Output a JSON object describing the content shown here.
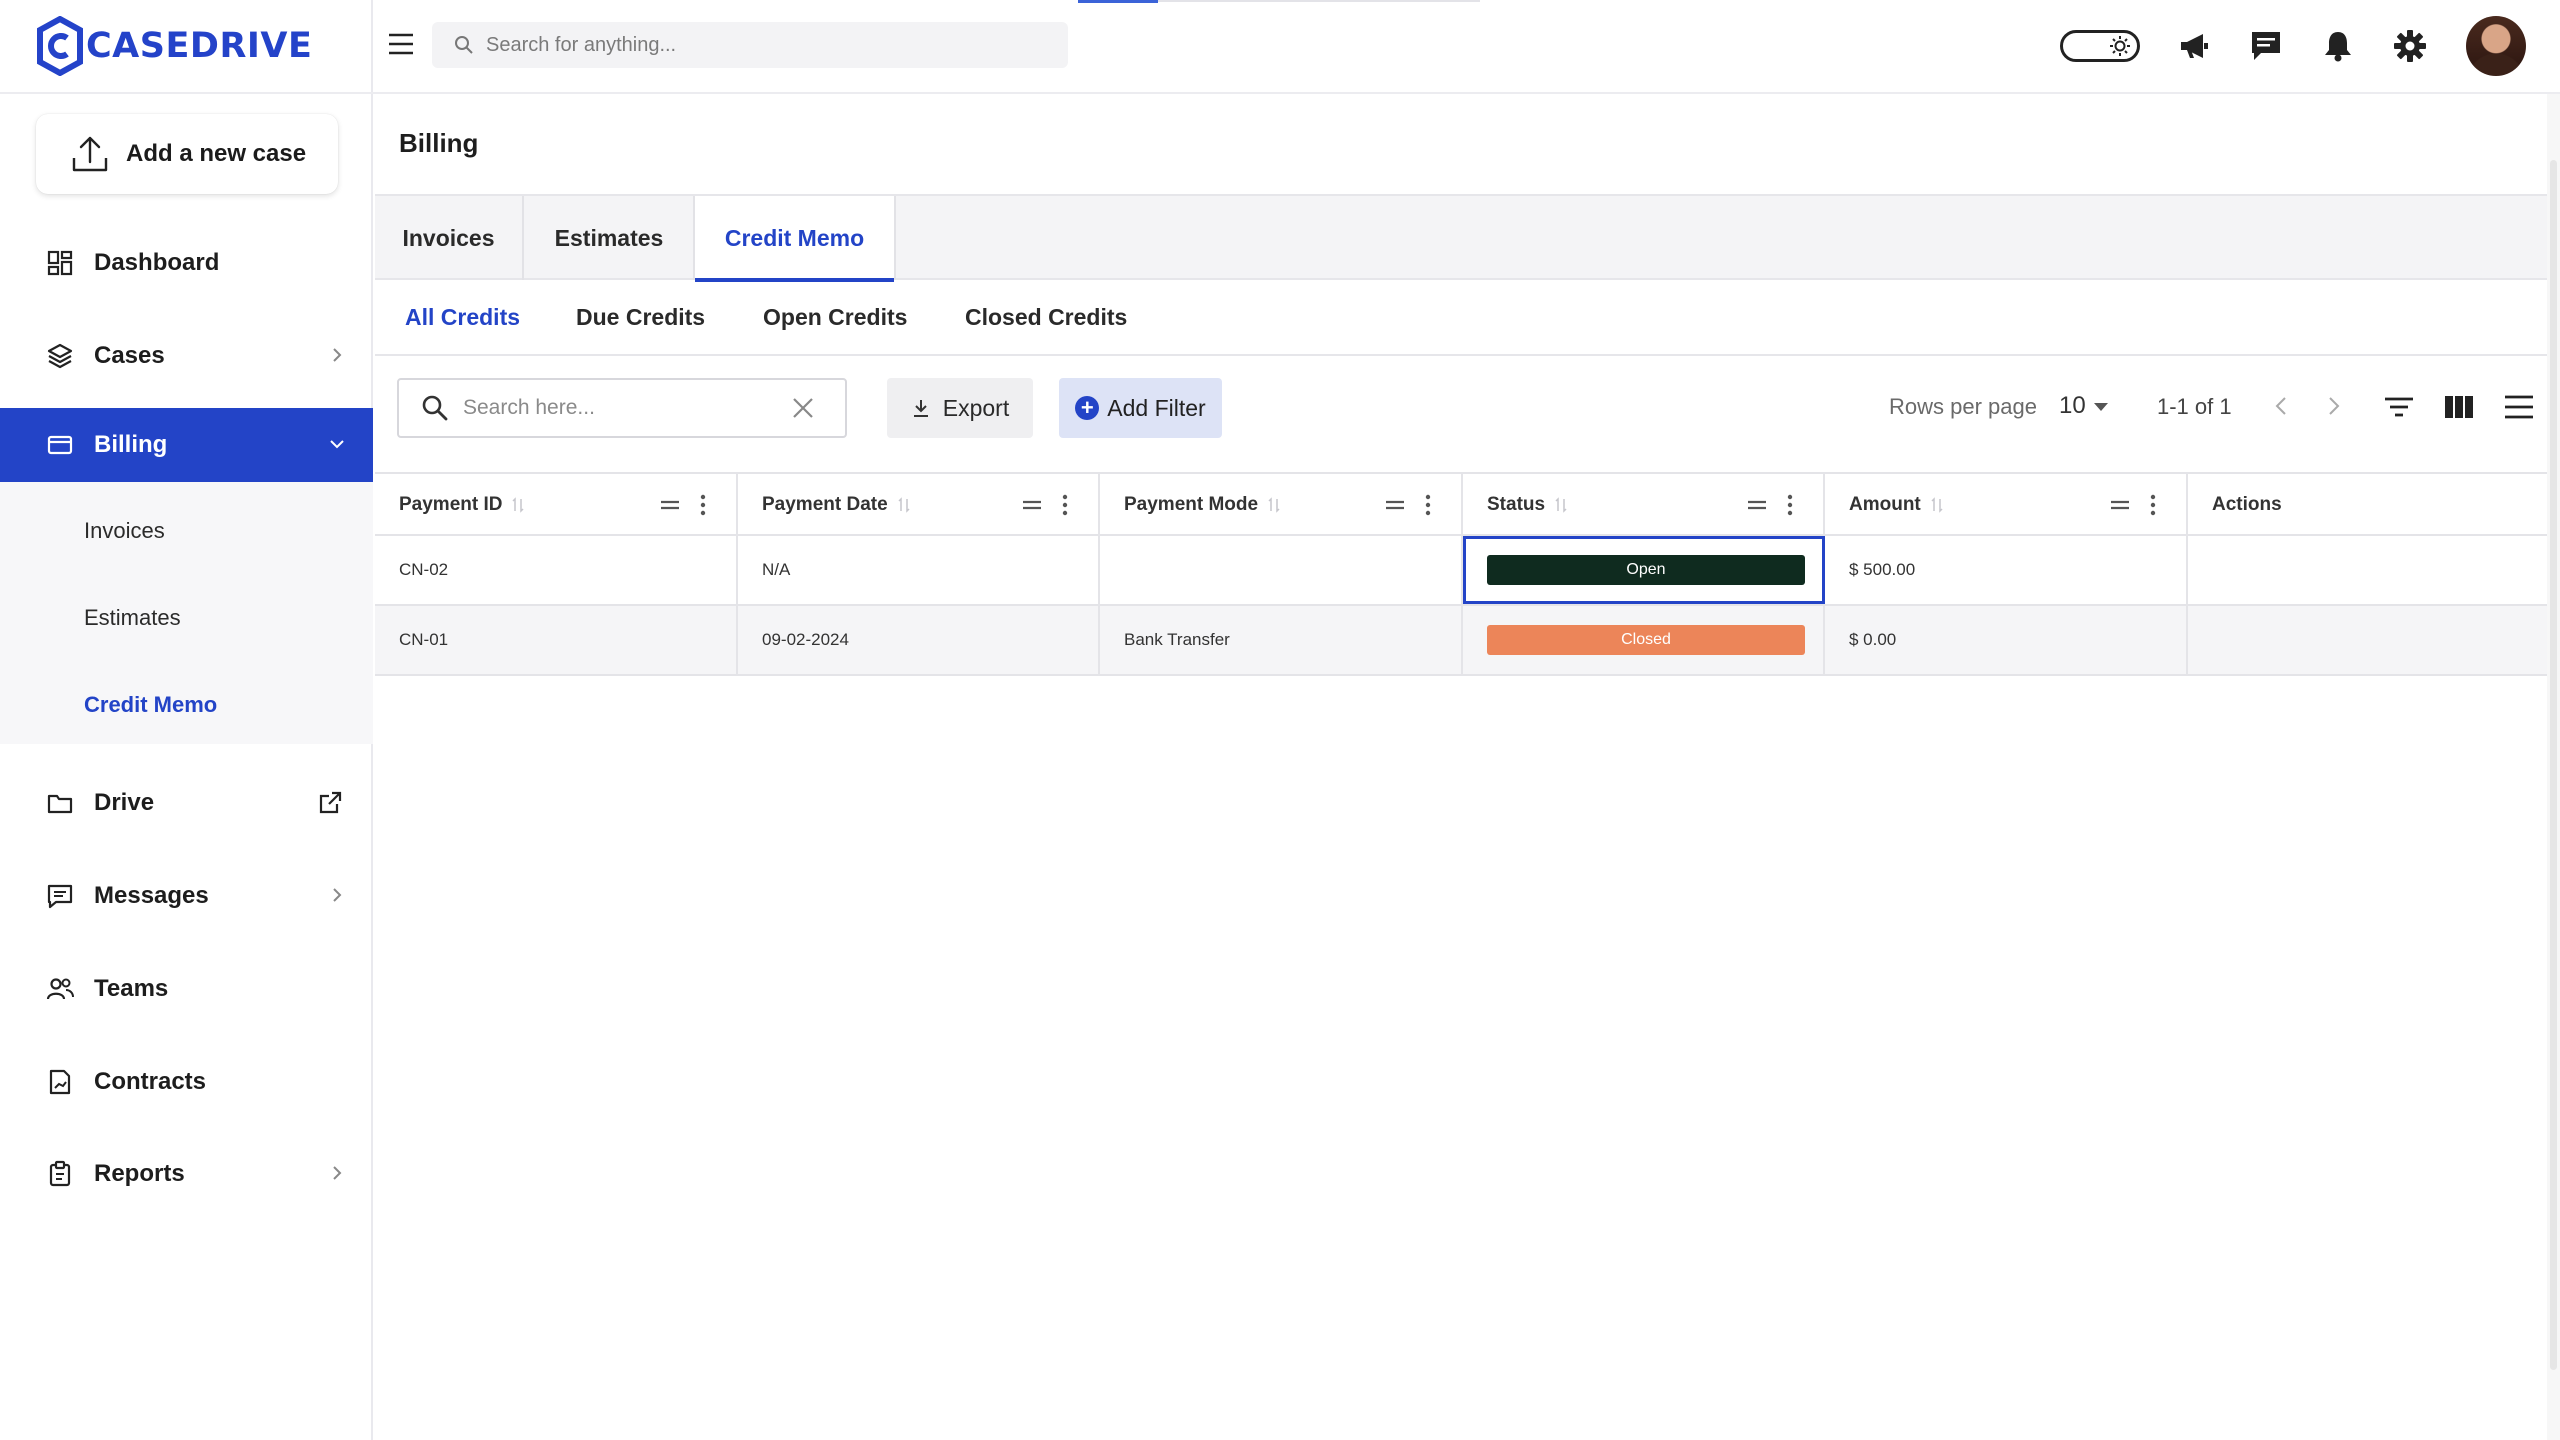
{
  "app": {
    "brand": "CASEDRIVE",
    "accent": "#2344c7"
  },
  "topbar": {
    "search_placeholder": "Search for anything...",
    "icons": [
      "menu-icon",
      "search-icon",
      "theme-toggle",
      "megaphone-icon",
      "chat-icon",
      "bell-icon",
      "gear-icon",
      "avatar"
    ]
  },
  "sidebar": {
    "add_case": "Add a new case",
    "items": [
      {
        "label": "Dashboard",
        "icon": "dashboard-icon"
      },
      {
        "label": "Cases",
        "icon": "layers-icon"
      },
      {
        "label": "Billing",
        "icon": "card-icon"
      },
      {
        "label": "Drive",
        "icon": "folder-icon"
      },
      {
        "label": "Messages",
        "icon": "message-icon"
      },
      {
        "label": "Teams",
        "icon": "team-icon"
      },
      {
        "label": "Contracts",
        "icon": "contract-icon"
      },
      {
        "label": "Reports",
        "icon": "clipboard-icon"
      }
    ],
    "billing_sub": [
      "Invoices",
      "Estimates",
      "Credit Memo"
    ]
  },
  "page": {
    "title": "Billing",
    "tabs": [
      "Invoices",
      "Estimates",
      "Credit Memo"
    ],
    "subtabs": [
      "All Credits",
      "Due Credits",
      "Open Credits",
      "Closed Credits"
    ]
  },
  "toolbar": {
    "search_placeholder": "Search here...",
    "export": "Export",
    "add_filter": "Add Filter",
    "rows_per_page_label": "Rows per page",
    "rows_per_page": "10",
    "range": "1-1 of 1"
  },
  "table": {
    "columns": [
      "Payment ID",
      "Payment Date",
      "Payment Mode",
      "Status",
      "Amount",
      "Actions"
    ],
    "rows": [
      {
        "id": "CN-02",
        "date": "N/A",
        "mode": "",
        "status": "Open",
        "amount": "$ 500.00"
      },
      {
        "id": "CN-01",
        "date": "09-02-2024",
        "mode": "Bank Transfer",
        "status": "Closed",
        "amount": "$ 0.00"
      }
    ]
  }
}
